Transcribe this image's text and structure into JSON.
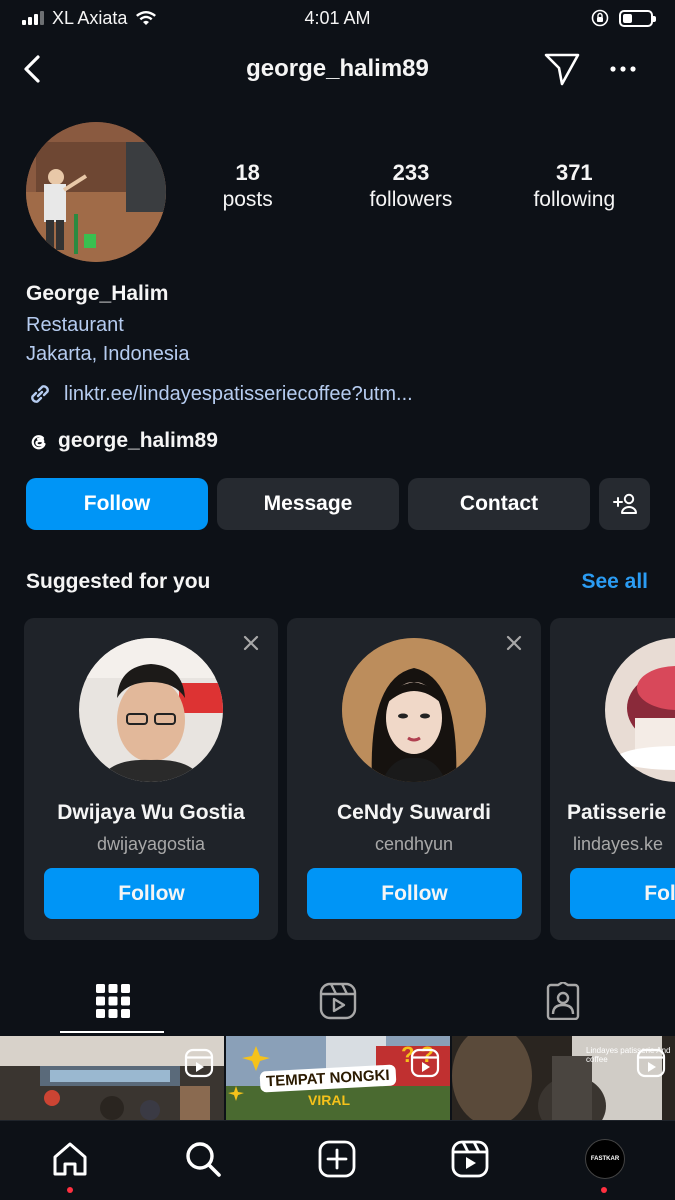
{
  "status_bar": {
    "carrier": "XL Axiata",
    "time": "4:01 AM"
  },
  "header": {
    "username": "george_halim89"
  },
  "profile": {
    "stats": [
      {
        "value": "18",
        "label": "posts"
      },
      {
        "value": "233",
        "label": "followers"
      },
      {
        "value": "371",
        "label": "following"
      }
    ],
    "display_name": "George_Halim",
    "category": "Restaurant",
    "location": "Jakarta, Indonesia",
    "link": "linktr.ee/lindayespatisseriecoffee?utm...",
    "threads_handle": "george_halim89"
  },
  "actions": {
    "follow": "Follow",
    "message": "Message",
    "contact": "Contact"
  },
  "suggested": {
    "title": "Suggested for you",
    "see_all": "See all",
    "cards": [
      {
        "name": "Dwijaya Wu Gostia",
        "handle": "dwijayagostia",
        "follow": "Follow"
      },
      {
        "name": "CeNdy Suwardi",
        "handle": "cendhyun",
        "follow": "Follow"
      },
      {
        "name": "Patisserie",
        "handle": "lindayes.ke",
        "follow": "Follow"
      }
    ]
  },
  "grid": {
    "tile2_text": "TEMPAT NONGKI",
    "tile2_sub": "VIRAL",
    "tile3_text": "Lindayes patisserie And coffee"
  },
  "bottom_nav": {
    "avatar_text": "FASTKAR"
  },
  "colors": {
    "background": "#0d1117",
    "accent": "#0095f6",
    "link": "#b6ccf0",
    "secondary_button": "#262a30",
    "card": "#1f2329",
    "notification_dot": "#ff3040"
  },
  "icons": [
    "signal-icon",
    "wifi-icon",
    "lock-rotation-icon",
    "battery-icon",
    "back-icon",
    "send-icon",
    "more-icon",
    "link-icon",
    "threads-icon",
    "add-person-icon",
    "close-icon",
    "grid-icon",
    "reels-icon",
    "tagged-icon",
    "home-icon",
    "search-icon",
    "create-icon"
  ]
}
